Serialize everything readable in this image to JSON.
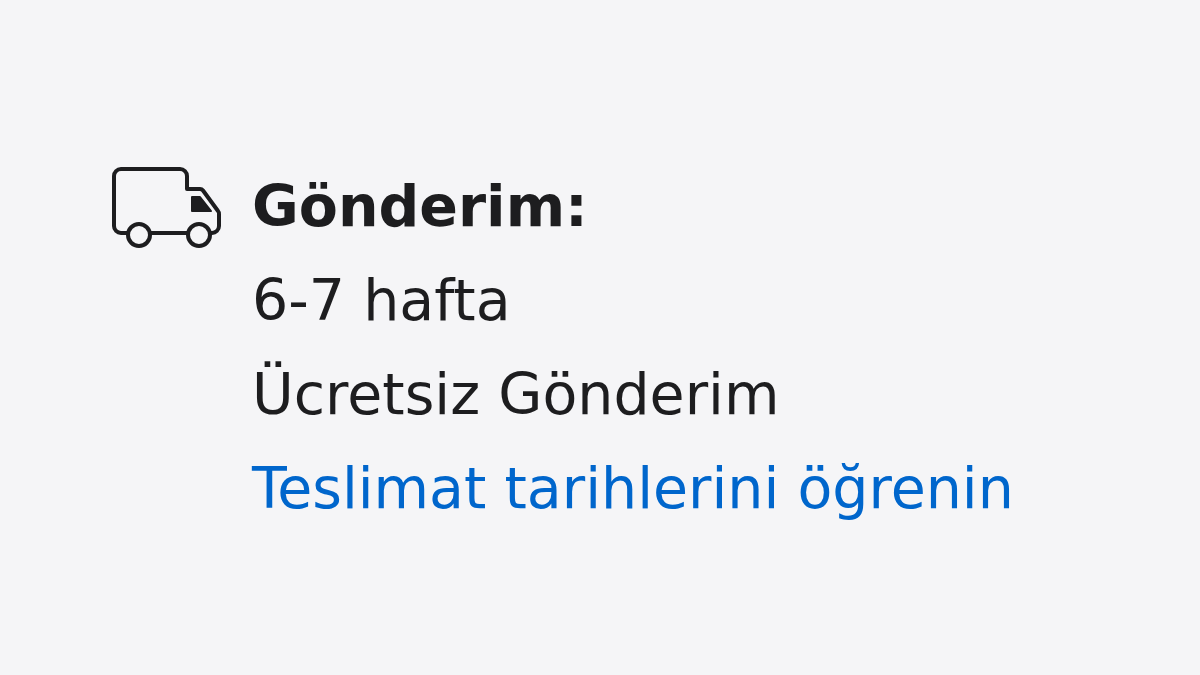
{
  "shipping": {
    "title": "Gönderim:",
    "lines": [
      "6-7 hafta",
      "Ücretsiz Gönderim"
    ],
    "link": "Teslimat tarihlerini öğrenin"
  }
}
